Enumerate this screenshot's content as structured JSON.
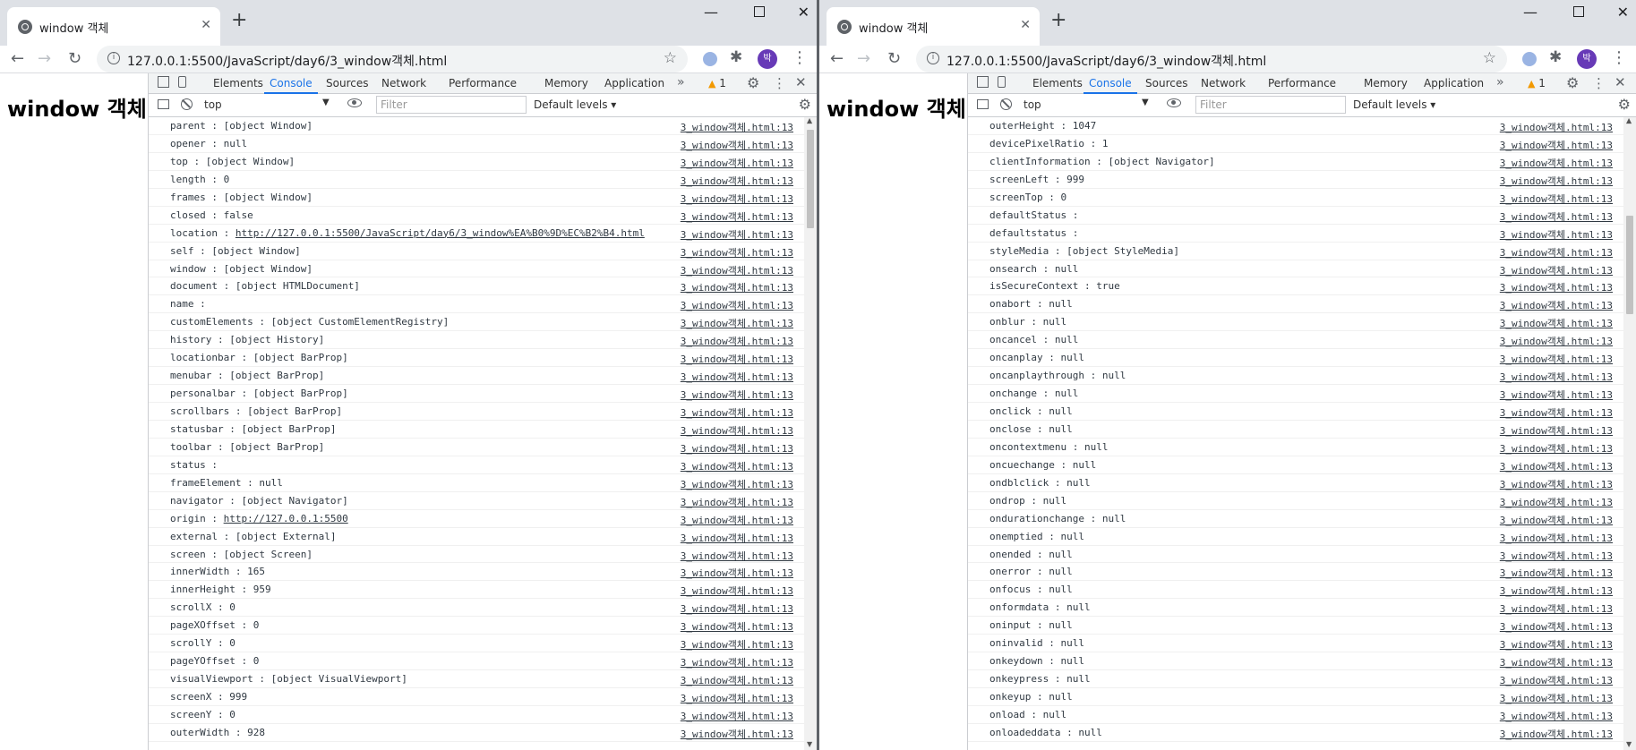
{
  "left": {
    "tab_title": "window 객체",
    "url": "127.0.0.1:5500/JavaScript/day6/3_window객체.html",
    "page_heading": "window 객체",
    "rows": [
      {
        "key": "parent",
        "val": "[object Window]"
      },
      {
        "key": "opener",
        "val": "null"
      },
      {
        "key": "top",
        "val": "[object Window]"
      },
      {
        "key": "length",
        "val": "0"
      },
      {
        "key": "frames",
        "val": "[object Window]"
      },
      {
        "key": "closed",
        "val": "false"
      },
      {
        "key": "location",
        "val": "http://127.0.0.1:5500/JavaScript/day6/3_window%EA%B0%9D%EC%B2%B4.html",
        "link": true
      },
      {
        "key": "self",
        "val": "[object Window]"
      },
      {
        "key": "window",
        "val": "[object Window]"
      },
      {
        "key": "document",
        "val": "[object HTMLDocument]"
      },
      {
        "key": "name",
        "val": ""
      },
      {
        "key": "customElements",
        "val": "[object CustomElementRegistry]"
      },
      {
        "key": "history",
        "val": "[object History]"
      },
      {
        "key": "locationbar",
        "val": "[object BarProp]"
      },
      {
        "key": "menubar",
        "val": "[object BarProp]"
      },
      {
        "key": "personalbar",
        "val": "[object BarProp]"
      },
      {
        "key": "scrollbars",
        "val": "[object BarProp]"
      },
      {
        "key": "statusbar",
        "val": "[object BarProp]"
      },
      {
        "key": "toolbar",
        "val": "[object BarProp]"
      },
      {
        "key": "status",
        "val": ""
      },
      {
        "key": "frameElement",
        "val": "null"
      },
      {
        "key": "navigator",
        "val": "[object Navigator]"
      },
      {
        "key": "origin",
        "val": "http://127.0.0.1:5500",
        "link": true
      },
      {
        "key": "external",
        "val": "[object External]"
      },
      {
        "key": "screen",
        "val": "[object Screen]"
      },
      {
        "key": "innerWidth",
        "val": "165"
      },
      {
        "key": "innerHeight",
        "val": "959"
      },
      {
        "key": "scrollX",
        "val": "0"
      },
      {
        "key": "pageXOffset",
        "val": "0"
      },
      {
        "key": "scrollY",
        "val": "0"
      },
      {
        "key": "pageYOffset",
        "val": "0"
      },
      {
        "key": "visualViewport",
        "val": "[object VisualViewport]"
      },
      {
        "key": "screenX",
        "val": "999"
      },
      {
        "key": "screenY",
        "val": "0"
      },
      {
        "key": "outerWidth",
        "val": "928"
      }
    ]
  },
  "right": {
    "tab_title": "window 객체",
    "url": "127.0.0.1:5500/JavaScript/day6/3_window객체.html",
    "page_heading": "window 객체",
    "rows": [
      {
        "key": "outerHeight",
        "val": "1047"
      },
      {
        "key": "devicePixelRatio",
        "val": "1"
      },
      {
        "key": "clientInformation",
        "val": "[object Navigator]"
      },
      {
        "key": "screenLeft",
        "val": "999"
      },
      {
        "key": "screenTop",
        "val": "0"
      },
      {
        "key": "defaultStatus",
        "val": ""
      },
      {
        "key": "defaultstatus",
        "val": ""
      },
      {
        "key": "styleMedia",
        "val": "[object StyleMedia]"
      },
      {
        "key": "onsearch",
        "val": "null"
      },
      {
        "key": "isSecureContext",
        "val": "true"
      },
      {
        "key": "onabort",
        "val": "null"
      },
      {
        "key": "onblur",
        "val": "null"
      },
      {
        "key": "oncancel",
        "val": "null"
      },
      {
        "key": "oncanplay",
        "val": "null"
      },
      {
        "key": "oncanplaythrough",
        "val": "null"
      },
      {
        "key": "onchange",
        "val": "null"
      },
      {
        "key": "onclick",
        "val": "null"
      },
      {
        "key": "onclose",
        "val": "null"
      },
      {
        "key": "oncontextmenu",
        "val": "null"
      },
      {
        "key": "oncuechange",
        "val": "null"
      },
      {
        "key": "ondblclick",
        "val": "null"
      },
      {
        "key": "ondrop",
        "val": "null"
      },
      {
        "key": "ondurationchange",
        "val": "null"
      },
      {
        "key": "onemptied",
        "val": "null"
      },
      {
        "key": "onended",
        "val": "null"
      },
      {
        "key": "onerror",
        "val": "null"
      },
      {
        "key": "onfocus",
        "val": "null"
      },
      {
        "key": "onformdata",
        "val": "null"
      },
      {
        "key": "oninput",
        "val": "null"
      },
      {
        "key": "oninvalid",
        "val": "null"
      },
      {
        "key": "onkeydown",
        "val": "null"
      },
      {
        "key": "onkeypress",
        "val": "null"
      },
      {
        "key": "onkeyup",
        "val": "null"
      },
      {
        "key": "onload",
        "val": "null"
      },
      {
        "key": "onloadeddata",
        "val": "null"
      }
    ]
  },
  "devtools": {
    "tabs": [
      "Elements",
      "Console",
      "Sources",
      "Network",
      "Performance",
      "Memory",
      "Application"
    ],
    "active_tab": "Console",
    "more": "»",
    "warning_count": "1",
    "context": "top",
    "filter_placeholder": "Filter",
    "levels": "Default levels ▾",
    "source": "3_window객체.html:13",
    "separator": " : "
  },
  "icons": {
    "close": "✕",
    "new_tab": "+",
    "minimize": "—",
    "back": "←",
    "forward": "→",
    "reload": "↻",
    "star": "☆",
    "puzzle": "✱",
    "kebab": "⋮",
    "gear": "⚙",
    "more_tabs": "»",
    "warning": "▲",
    "dropdown": "▼",
    "info": "i"
  },
  "avatar_text": "박",
  "colors": {
    "accent": "#1a73e8",
    "avatar": "#673ab7",
    "warning": "#f29900"
  }
}
